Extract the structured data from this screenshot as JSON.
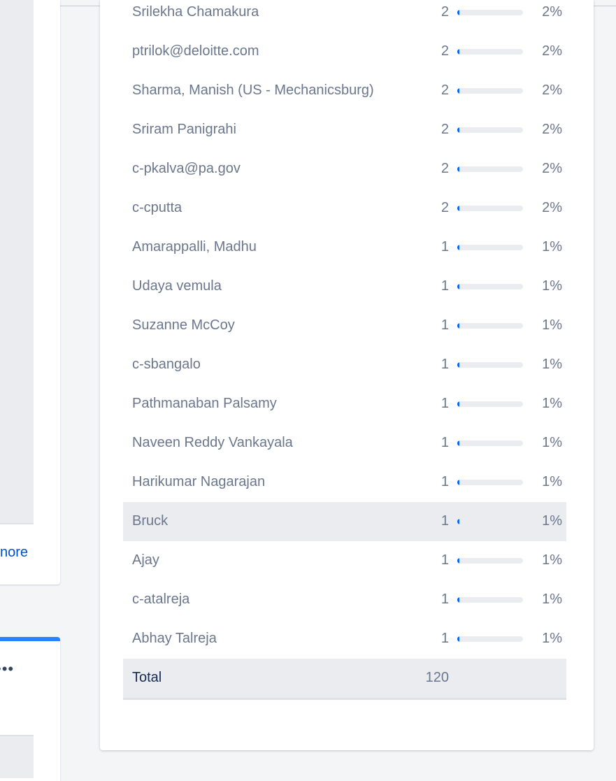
{
  "left_panel": {
    "more_link": "nore",
    "menu_dots": "•••"
  },
  "table": {
    "rows": [
      {
        "name": "Srilekha Chamakura",
        "count": "2",
        "percent": "2%",
        "fraction": 0.02
      },
      {
        "name": "ptrilok@deloitte.com",
        "count": "2",
        "percent": "2%",
        "fraction": 0.02
      },
      {
        "name": "Sharma, Manish (US - Mechanicsburg)",
        "count": "2",
        "percent": "2%",
        "fraction": 0.02
      },
      {
        "name": "Sriram Panigrahi",
        "count": "2",
        "percent": "2%",
        "fraction": 0.02
      },
      {
        "name": "c-pkalva@pa.gov",
        "count": "2",
        "percent": "2%",
        "fraction": 0.02
      },
      {
        "name": "c-cputta",
        "count": "2",
        "percent": "2%",
        "fraction": 0.02
      },
      {
        "name": "Amarappalli, Madhu",
        "count": "1",
        "percent": "1%",
        "fraction": 0.01
      },
      {
        "name": "Udaya vemula",
        "count": "1",
        "percent": "1%",
        "fraction": 0.01
      },
      {
        "name": "Suzanne McCoy",
        "count": "1",
        "percent": "1%",
        "fraction": 0.01
      },
      {
        "name": "c-sbangalo",
        "count": "1",
        "percent": "1%",
        "fraction": 0.01
      },
      {
        "name": "Pathmanaban Palsamy",
        "count": "1",
        "percent": "1%",
        "fraction": 0.01
      },
      {
        "name": "Naveen Reddy Vankayala",
        "count": "1",
        "percent": "1%",
        "fraction": 0.01
      },
      {
        "name": "Harikumar Nagarajan",
        "count": "1",
        "percent": "1%",
        "fraction": 0.01
      },
      {
        "name": "Bruck",
        "count": "1",
        "percent": "1%",
        "fraction": 0.01,
        "highlighted": true
      },
      {
        "name": "Ajay",
        "count": "1",
        "percent": "1%",
        "fraction": 0.01
      },
      {
        "name": "c-atalreja",
        "count": "1",
        "percent": "1%",
        "fraction": 0.01
      },
      {
        "name": "Abhay Talreja",
        "count": "1",
        "percent": "1%",
        "fraction": 0.01
      }
    ],
    "total_label": "Total",
    "total_value": "120"
  },
  "colors": {
    "bar_fill": "#0065ff",
    "bar_track": "#ebecf0",
    "link": "#0052cc",
    "accent_top": "#2684ff"
  }
}
